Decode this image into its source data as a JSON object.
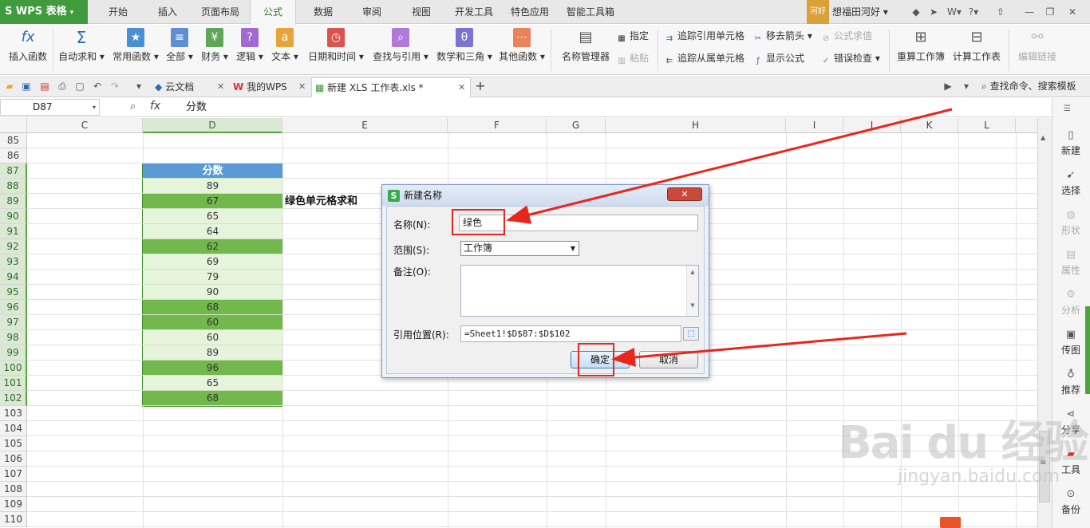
{
  "app": {
    "name": "WPS 表格"
  },
  "menu_tabs": [
    "开始",
    "插入",
    "页面布局",
    "公式",
    "数据",
    "审阅",
    "视图",
    "开发工具",
    "特色应用",
    "智能工具箱"
  ],
  "active_menu_tab": "公式",
  "user": {
    "badge": "河好",
    "name": "想福田河好"
  },
  "ribbon": {
    "insert_function": "插入函数",
    "autosum": "自动求和",
    "common_funcs": "常用函数",
    "all": "全部",
    "finance": "财务",
    "logic": "逻辑",
    "text": "文本",
    "datetime": "日期和时间",
    "lookup": "查找与引用",
    "math": "数学和三角",
    "other": "其他函数",
    "name_manager": "名称管理器",
    "define": "指定",
    "paste": "粘贴",
    "trace_precedents": "追踪引用单元格",
    "trace_dependents": "追踪从属单元格",
    "remove_arrows": "移去箭头",
    "show_formulas": "显示公式",
    "eval_formula": "公式求值",
    "error_check": "错误检查",
    "recalc_workbook": "重算工作簿",
    "calc_sheet": "计算工作表",
    "edit_links": "编辑链接"
  },
  "doc_tabs": [
    {
      "label": "云文档"
    },
    {
      "label": "我的WPS"
    },
    {
      "label": "新建 XLS 工作表.xls *"
    }
  ],
  "search_cmd": "查找命令、搜索模板",
  "formula_bar": {
    "name_box": "D87",
    "fx": "fx",
    "value": "分数"
  },
  "columns": [
    "C",
    "D",
    "E",
    "F",
    "G",
    "H",
    "I",
    "J",
    "K",
    "L"
  ],
  "rows": [
    "85",
    "86",
    "87",
    "88",
    "89",
    "90",
    "91",
    "92",
    "93",
    "94",
    "95",
    "96",
    "97",
    "98",
    "99",
    "100",
    "101",
    "102",
    "103",
    "104",
    "105",
    "106",
    "107",
    "108",
    "109",
    "110"
  ],
  "cells": {
    "header": "分数",
    "scores": [
      "89",
      "67",
      "65",
      "64",
      "62",
      "69",
      "79",
      "90",
      "68",
      "60",
      "60",
      "89",
      "96",
      "65",
      "68"
    ],
    "green_label": "绿色单元格求和"
  },
  "sidebar": [
    "新建",
    "选择",
    "形状",
    "属性",
    "分析",
    "传图",
    "推荐",
    "分享",
    "工具",
    "备份"
  ],
  "dialog": {
    "title": "新建名称",
    "name_label": "名称(N):",
    "name_value": "绿色",
    "scope_label": "范围(S):",
    "scope_value": "工作簿",
    "note_label": "备注(O):",
    "ref_label": "引用位置(R):",
    "ref_value": "=Sheet1!$D$87:$D$102",
    "ok": "确定",
    "cancel": "取消"
  },
  "watermark": {
    "logo": "Bai du 经验",
    "url": "jingyan.baidu.com"
  },
  "colors": {
    "accent": "#3f9b3c",
    "cell_green": "#73b84c",
    "cell_light": "#e6f4dc",
    "header_blue": "#5b9bd5",
    "annotation_red": "#e8261c"
  }
}
